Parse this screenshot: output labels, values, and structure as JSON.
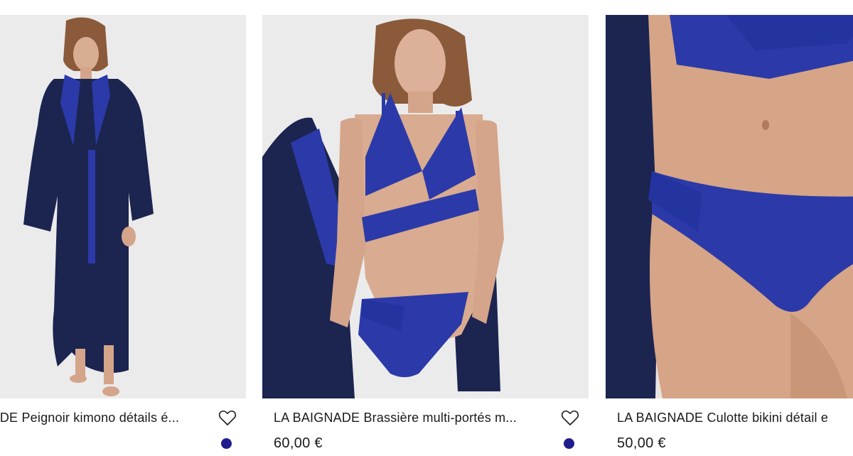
{
  "products": [
    {
      "title": "LA BAIGNADE Peignoir kimono détails é...",
      "price": "",
      "swatch_color": "#1f1d8c",
      "image_icon": "product-photo-kimono"
    },
    {
      "title": "LA BAIGNADE Brassière multi-portés m...",
      "price": "60,00 €",
      "swatch_color": "#1f1d8c",
      "image_icon": "product-photo-bra"
    },
    {
      "title": "LA BAIGNADE Culotte bikini détail e",
      "price": "50,00 €",
      "swatch_color": "#1f1d8c",
      "image_icon": "product-photo-bikini"
    }
  ],
  "colors": {
    "navy": "#1b2550",
    "cobalt": "#2b3aa8",
    "skin": "#d7a88a",
    "background": "#e9e9ea"
  },
  "wishlist_icon": "heart-outline-icon"
}
